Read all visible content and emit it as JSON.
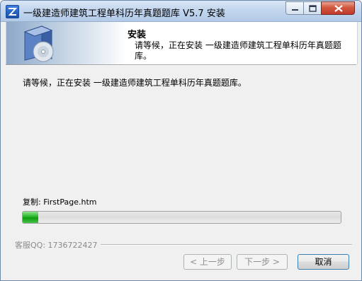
{
  "window": {
    "title": "一级建造师建筑工程单科历年真题题库 V5.7 安装",
    "controls": {
      "minimize_icon": "minimize-icon",
      "maximize_icon": "maximize-icon",
      "close_icon": "close-icon"
    }
  },
  "header": {
    "title": "安装",
    "subtitle": "请等候，正在安装 一级建造师建筑工程单科历年真题题库。",
    "icon": "install-box-icon"
  },
  "body": {
    "status_text": "请等候，正在安装 一级建造师建筑工程单科历年真题题库。",
    "copy_label": "复制: FirstPage.htm",
    "progress_fraction": 0.05
  },
  "footer": {
    "brand": "客服QQ: 1736722427",
    "buttons": {
      "back": "< 上一步",
      "next": "下一步 >",
      "cancel": "取消"
    }
  },
  "colors": {
    "progress": "#27b627",
    "title_bar": "#c3d6ee",
    "close_button": "#c0392b"
  }
}
